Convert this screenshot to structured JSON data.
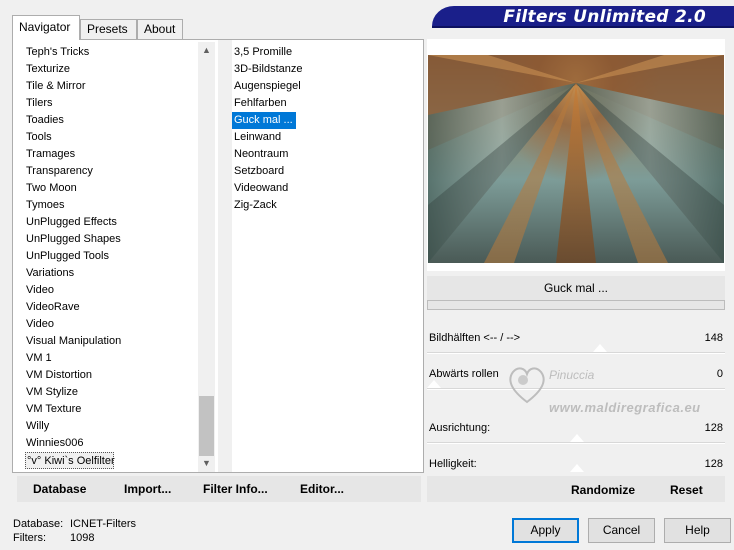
{
  "tabs": [
    "Navigator",
    "Presets",
    "About"
  ],
  "banner_title": "Filters Unlimited 2.0",
  "categories": [
    "Teph's Tricks",
    "Texturize",
    "Tile & Mirror",
    "Tilers",
    "Toadies",
    "Tools",
    "Tramages",
    "Transparency",
    "Two Moon",
    "Tymoes",
    "UnPlugged Effects",
    "UnPlugged Shapes",
    "UnPlugged Tools",
    "Variations",
    "Video",
    "VideoRave",
    "Video",
    "Visual Manipulation",
    "VM 1",
    "VM Distortion",
    "VM Stylize",
    "VM Texture",
    "Willy",
    "Winnies006",
    "°v° Kiwi`s Oelfilter"
  ],
  "selected_category": "°v° Kiwi`s Oelfilter",
  "filters": [
    "3,5 Promille",
    "3D-Bildstanze",
    "Augenspiegel",
    "Fehlfarben",
    "Guck mal ...",
    "Leinwand",
    "Neontraum",
    "Setzboard",
    "Videowand",
    "Zig-Zack"
  ],
  "selected_filter": "Guck mal ...",
  "links": {
    "database": "Database",
    "import": "Import...",
    "filter_info": "Filter Info...",
    "editor": "Editor..."
  },
  "current_filter_name": "Guck mal ...",
  "params": [
    {
      "label": "Bildhälften <-- / -->",
      "value": "148"
    },
    {
      "label": "Abwärts rollen",
      "value": "0"
    },
    {
      "label": "Ausrichtung:",
      "value": "128"
    },
    {
      "label": "Helligkeit:",
      "value": "128"
    }
  ],
  "actions": {
    "randomize": "Randomize",
    "reset": "Reset"
  },
  "status": {
    "database_label": "Database:",
    "database_value": "ICNET-Filters",
    "filters_label": "Filters:",
    "filters_value": "1098"
  },
  "buttons": {
    "apply": "Apply",
    "cancel": "Cancel",
    "help": "Help"
  },
  "watermark": {
    "name": "Pinuccia",
    "url": "www.maldiregrafica.eu"
  },
  "colors": {
    "banner": "#1a1f8a",
    "selection": "#0078d7"
  }
}
